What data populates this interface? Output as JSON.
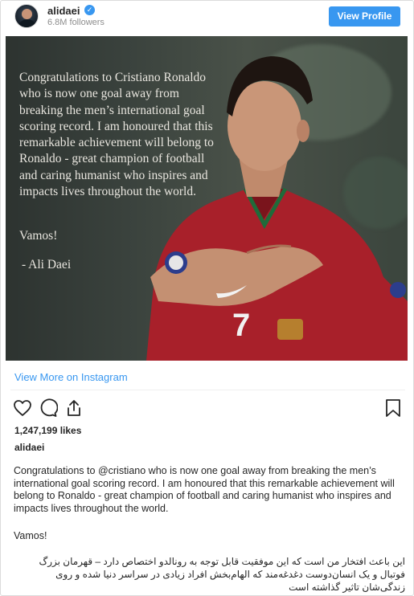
{
  "header": {
    "username": "alidaei",
    "verified_icon": "verified-check-icon",
    "followers": "6.8M followers",
    "view_profile_label": "View Profile"
  },
  "photo": {
    "overlay_text": "Congratulations to Cristiano Ronaldo who is now one goal away from breaking the men’s international goal scoring record. I am honoured that this remarkable achievement will belong to Ronaldo - great champion of football and caring humanist who inspires and impacts lives throughout the world.",
    "overlay_vamos": "Vamos!",
    "overlay_signature": "- Ali Daei",
    "jersey_number": "7"
  },
  "view_more_label": "View More on Instagram",
  "actions": {
    "like_icon": "heart-icon",
    "comment_icon": "comment-icon",
    "share_icon": "share-icon",
    "save_icon": "bookmark-icon"
  },
  "likes": "1,247,199 likes",
  "caption": {
    "username": "alidaei",
    "text_before_mention": "Congratulations to ",
    "mention": "@cristiano",
    "text_after_mention": " who is now one goal away from breaking the men’s international goal scoring record. I am honoured that this remarkable achievement will belong to Ronaldo - great champion of football and caring humanist who inspires and impacts lives throughout the world.",
    "vamos": "Vamos!",
    "persian": "این باعث افتخار من است که این موفقیت قابل توجه به رونالدو اختصاص دارد – قهرمان بزرگ فوتبال و یک انسان‌دوست دغدغه‌مند که الهام‌بخش افراد زیادی در سراسر دنیا شده و روی زندگی‌شان تاثیر گذاشته است"
  },
  "colors": {
    "accent": "#3897f0",
    "text": "#262626",
    "muted": "#8e8e8e",
    "jersey": "#a8202a"
  }
}
